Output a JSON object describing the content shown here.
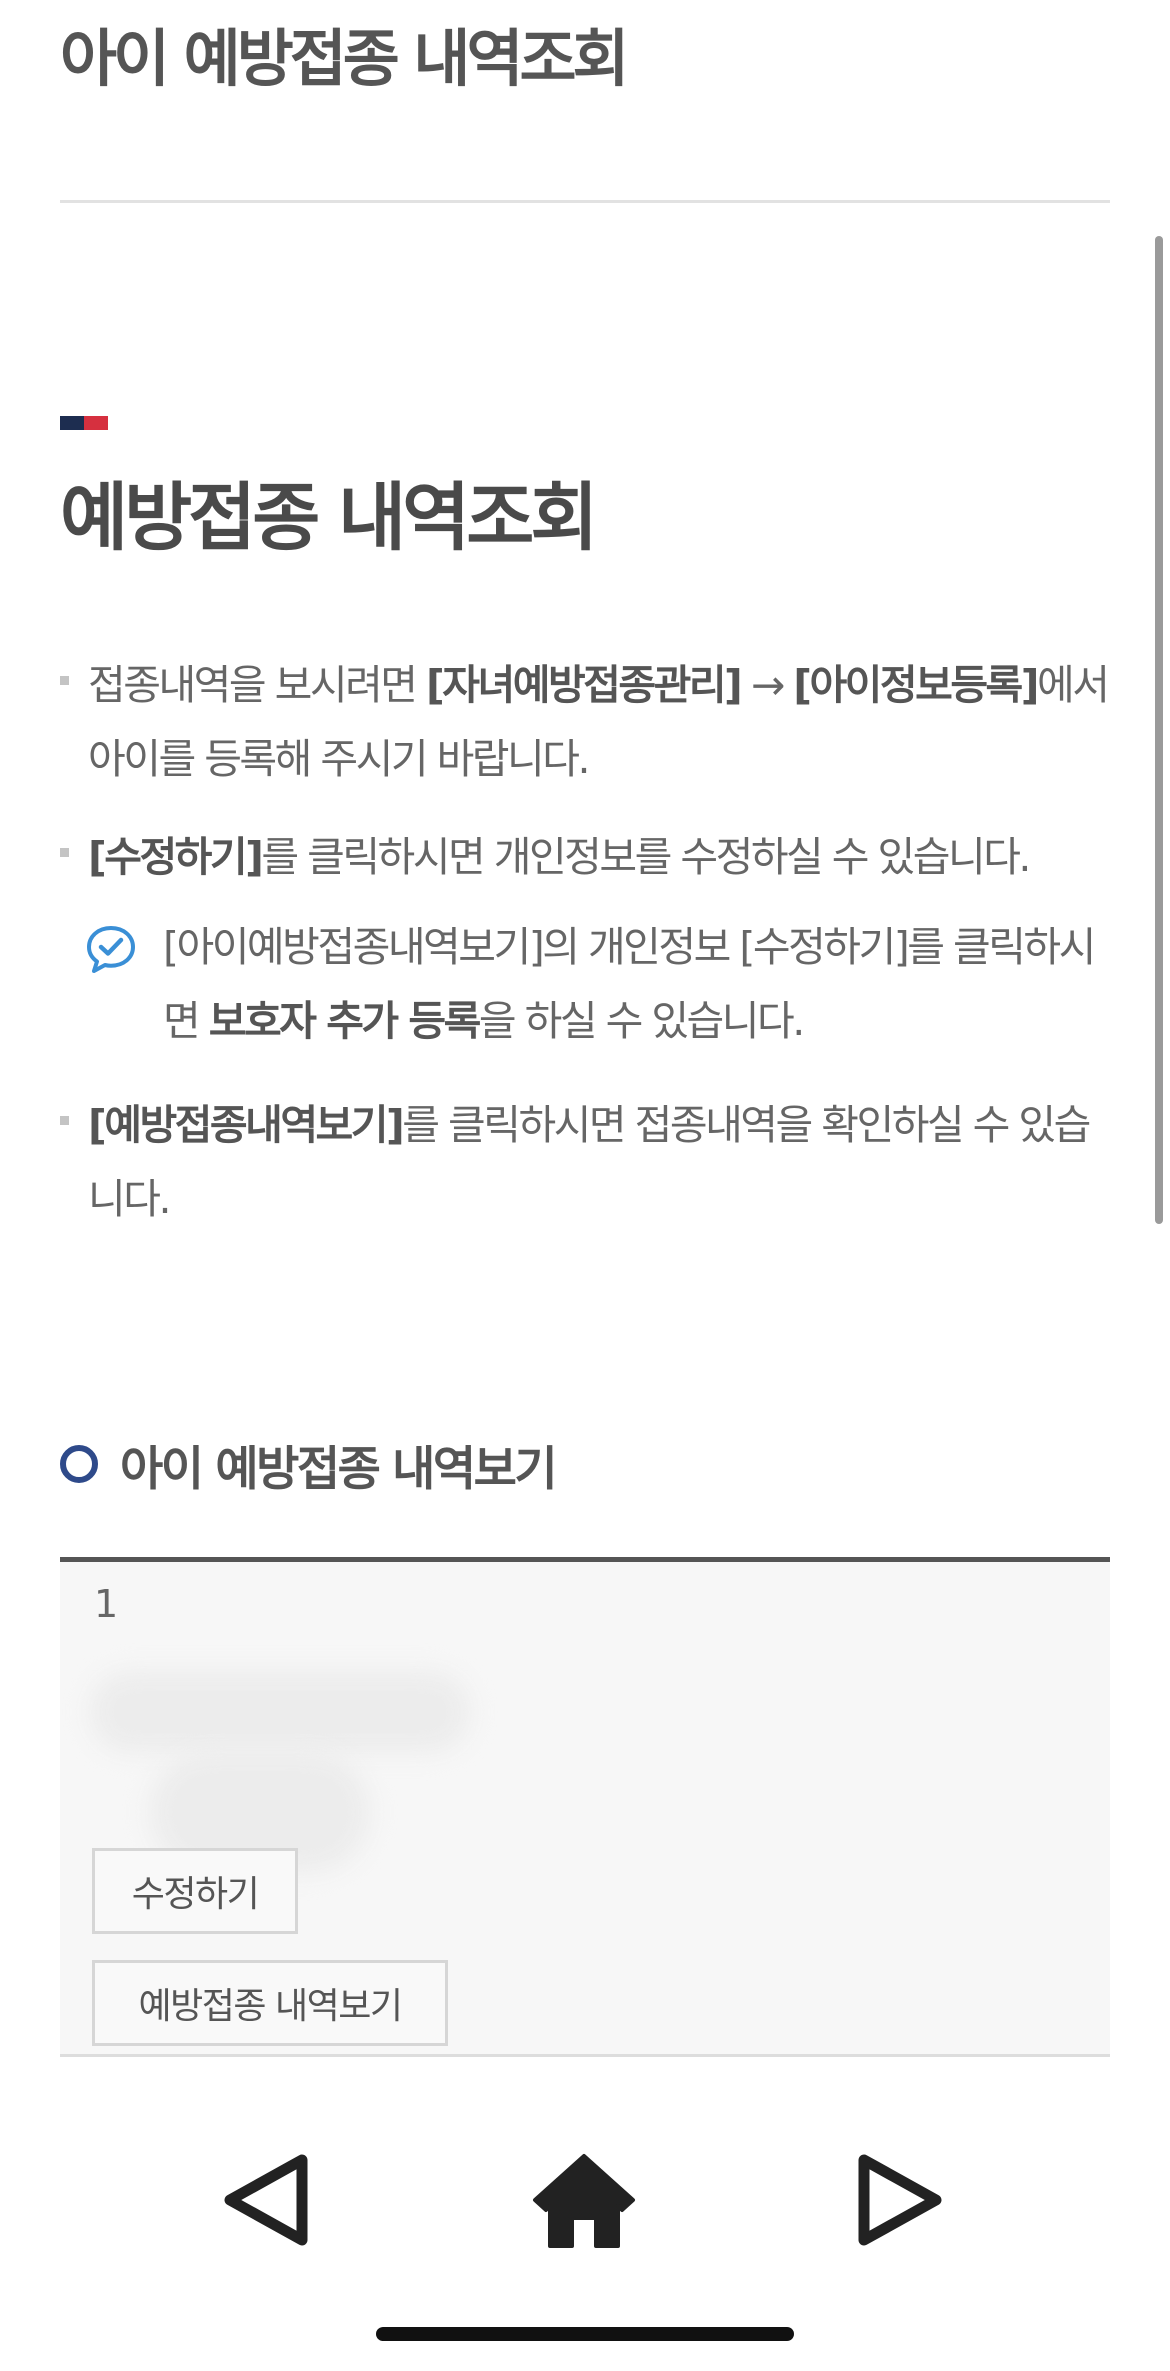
{
  "header": {
    "title": "아이 예방접종 내역조회"
  },
  "section": {
    "title": "예방접종 내역조회"
  },
  "notes": {
    "n1": {
      "pre": "접종내역을 보시려면 ",
      "b1": "[자녀예방접종관리]",
      "arrow": " → ",
      "b2": "[아이정보등록]",
      "post": "에서 아이를 등록해 주시기 바랍니다."
    },
    "n2": {
      "b1": "[수정하기]",
      "post": "를 클릭하시면 개인정보를 수정하실 수 있습니다."
    },
    "n2sub": {
      "pre": "[아이예방접종내역보기]의 개인정보 [수정하기]를 클릭하시면 ",
      "b1": "보호자 추가 등록",
      "post": "을 하실 수 있습니다."
    },
    "n3": {
      "b1": "[예방접종내역보기]",
      "post": "를 클릭하시면 접종내역을 확인하실 수 있습니다."
    }
  },
  "child_list": {
    "heading": "아이 예방접종 내역보기",
    "items": [
      {
        "index": "1",
        "edit_label": "수정하기",
        "history_label": "예방접종 내역보기"
      }
    ]
  },
  "icons": {
    "chat": "chat-check-icon",
    "back": "back-triangle-icon",
    "home": "home-icon",
    "forward": "forward-triangle-icon"
  },
  "colors": {
    "flag_navy": "#1d2d50",
    "flag_red": "#d6303f",
    "ring": "#2e4a8a",
    "chat_icon": "#3a8fd6",
    "text": "#555555"
  }
}
